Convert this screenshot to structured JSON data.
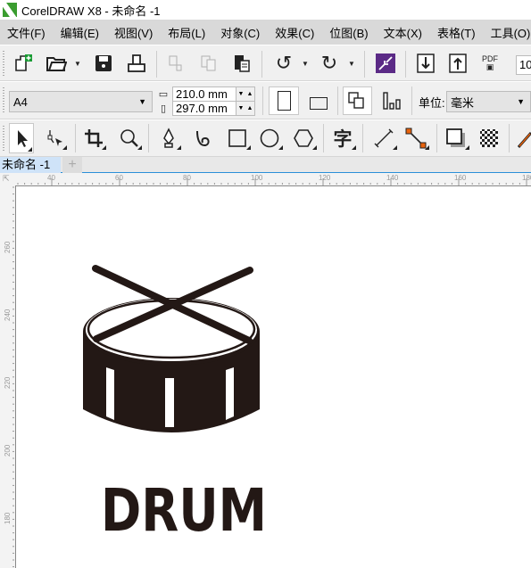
{
  "window": {
    "title": "CorelDRAW X8 - 未命名 -1"
  },
  "menu": [
    "文件(F)",
    "编辑(E)",
    "视图(V)",
    "布局(L)",
    "对象(C)",
    "效果(C)",
    "位图(B)",
    "文本(X)",
    "表格(T)",
    "工具(O)"
  ],
  "standard_toolbar": {
    "icons": [
      "new-document-icon",
      "open-icon",
      "save-icon",
      "print-icon",
      "cut-icon",
      "copy-icon",
      "paste-icon",
      "undo-icon",
      "redo-icon",
      "search-content-icon",
      "import-icon",
      "export-icon",
      "publish-pdf-icon"
    ],
    "pdf_label": "PDF",
    "zoom_value": "10"
  },
  "property_bar": {
    "page_size": "A4",
    "width": "210.0 mm",
    "height": "297.0 mm",
    "units_label": "单位:",
    "units_value": "毫米"
  },
  "toolbox": {
    "tools": [
      "pick-tool",
      "shape-tool",
      "crop-tool",
      "zoom-tool",
      "pen-tool",
      "artistic-media-tool",
      "rectangle-tool",
      "ellipse-tool",
      "polygon-tool",
      "text-tool",
      "dimension-tool",
      "connector-tool",
      "drop-shadow-tool",
      "transparency-tool",
      "color-eyedropper-tool"
    ],
    "text_tool_glyph": "字"
  },
  "document_tabs": [
    {
      "label": "未命名 -1",
      "active": true
    }
  ],
  "add_tab_label": "+",
  "ruler": {
    "horizontal": [
      "40",
      "60",
      "80",
      "100",
      "120",
      "140",
      "160",
      "180"
    ],
    "vertical": [
      "260",
      "240",
      "220",
      "200",
      "180"
    ]
  },
  "artwork": {
    "text": "DRUM",
    "color": "#231815"
  },
  "colors": {
    "accent": "#2b8fd8",
    "logo": "#3a9c2f",
    "purple": "#5b2a86",
    "orange": "#e8620c"
  }
}
